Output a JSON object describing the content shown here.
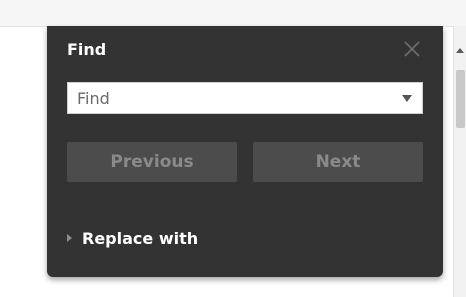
{
  "find_panel": {
    "title": "Find",
    "search": {
      "placeholder": "Find",
      "value": ""
    },
    "buttons": {
      "previous_label": "Previous",
      "next_label": "Next"
    },
    "replace_toggle_label": "Replace with",
    "close_icon": "close-icon",
    "dropdown_icon": "chevron-down-icon",
    "expand_icon": "chevron-right-icon"
  },
  "colors": {
    "panel_bg": "#333333",
    "button_bg": "#4c4c4c",
    "button_text_disabled": "#8a8a8a",
    "title_text": "#ffffff"
  }
}
